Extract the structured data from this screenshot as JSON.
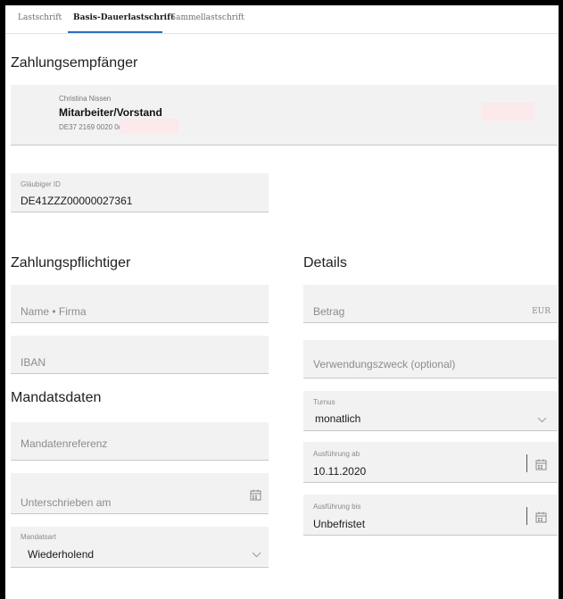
{
  "tabs": [
    {
      "label": "Lastschrift"
    },
    {
      "label": "Basis-Dauerlastschrift"
    },
    {
      "label": "Sammellastschrift"
    }
  ],
  "payee": {
    "section_title": "Zahlungsempfänger",
    "account_holder": "Christina Nissen",
    "account_name": "Mitarbeiter/Vorstand",
    "iban_partial": "DE37 2169 0020 0("
  },
  "creditor": {
    "label": "Gläubiger ID",
    "value": "DE41ZZZ00000027361"
  },
  "payer": {
    "section_title": "Zahlungspflichtiger",
    "name_placeholder": "Name • Firma",
    "iban_placeholder": "IBAN"
  },
  "mandate": {
    "section_title": "Mandatsdaten",
    "reference_placeholder": "Mandatenreferenz",
    "signed_placeholder": "Unterschrieben am",
    "type_label": "Mandatsart",
    "type_value": "Wiederholend"
  },
  "details": {
    "section_title": "Details",
    "amount_placeholder": "Betrag",
    "currency": "EUR",
    "purpose_placeholder": "Verwendungszweck (optional)",
    "interval_label": "Turnus",
    "interval_value": "monatlich",
    "start_label": "Ausführung ab",
    "start_value": "10.11.2020",
    "end_label": "Ausführung bis",
    "end_value": "Unbefristet"
  },
  "colors": {
    "accent": "#2a6ebd",
    "field_bg": "#f2f2f2",
    "redaction": "#fbe9ec"
  },
  "icons": [
    "calendar-icon",
    "chevron-down-icon"
  ]
}
